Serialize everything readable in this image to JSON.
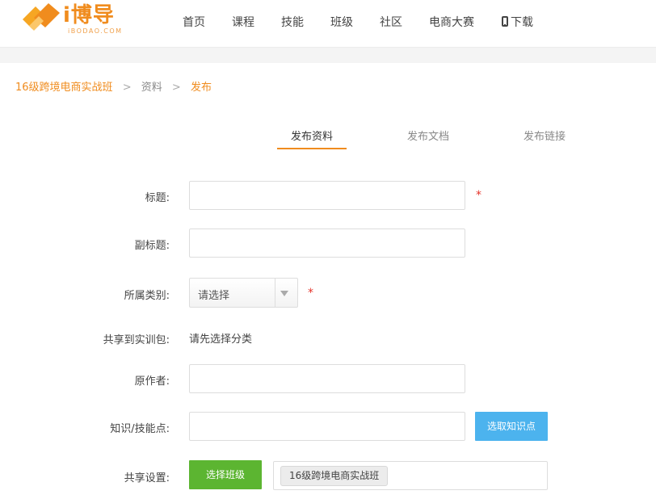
{
  "header": {
    "logo_text": "i博导",
    "logo_sub": "iBODAO.COM",
    "nav": [
      {
        "label": "首页",
        "icon": ""
      },
      {
        "label": "课程",
        "icon": ""
      },
      {
        "label": "技能",
        "icon": ""
      },
      {
        "label": "班级",
        "icon": ""
      },
      {
        "label": "社区",
        "icon": ""
      },
      {
        "label": "电商大赛",
        "icon": ""
      },
      {
        "label": "下载",
        "icon": "phone-icon"
      }
    ]
  },
  "breadcrumb": {
    "items": [
      "16级跨境电商实战班",
      "资料",
      "发布"
    ],
    "separator": ">"
  },
  "tabs": [
    {
      "label": "发布资料",
      "active": true
    },
    {
      "label": "发布文档",
      "active": false
    },
    {
      "label": "发布链接",
      "active": false
    }
  ],
  "form": {
    "title_label": "标题:",
    "subtitle_label": "副标题:",
    "category_label": "所属类别:",
    "category_value": "请选择",
    "share_pack_label": "共享到实训包:",
    "share_pack_hint": "请先选择分类",
    "author_label": "原作者:",
    "knowledge_label": "知识/技能点:",
    "knowledge_button": "选取知识点",
    "share_label": "共享设置:",
    "class_button": "选择班级",
    "selected_class": "16级跨境电商实战班",
    "required_mark": "*"
  },
  "colors": {
    "accent": "#f08c1e",
    "required": "#e5342b",
    "blue_button": "#4cb3ee",
    "green_button": "#5cb531"
  }
}
